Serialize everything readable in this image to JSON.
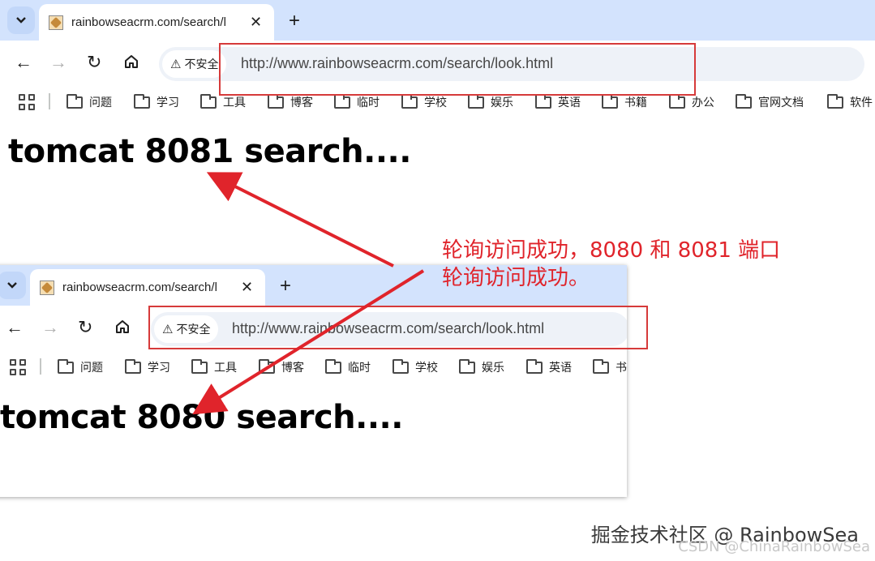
{
  "window_top": {
    "tab_title": "rainbowseacrm.com/search/l",
    "url": "http://www.rainbowseacrm.com/search/look.html",
    "security_label": "不安全",
    "bookmarks": [
      "问题",
      "学习",
      "工具",
      "博客",
      "临时",
      "学校",
      "娱乐",
      "英语",
      "书籍",
      "办公",
      "官网文档",
      "软件"
    ],
    "heading": "tomcat 8081 search...."
  },
  "window_bottom": {
    "tab_title": "rainbowseacrm.com/search/l",
    "url": "http://www.rainbowseacrm.com/search/look.html",
    "security_label": "不安全",
    "bookmarks": [
      "问题",
      "学习",
      "工具",
      "博客",
      "临时",
      "学校",
      "娱乐",
      "英语",
      "书"
    ],
    "heading": "tomcat 8080 search...."
  },
  "icons": {
    "tab_menu": "chevron-down-icon",
    "close": "close-icon",
    "new_tab": "plus-icon",
    "back": "back-arrow-icon",
    "forward": "forward-arrow-icon",
    "reload": "reload-icon",
    "home": "home-icon",
    "warning": "warning-icon",
    "apps": "apps-grid-icon",
    "folder": "folder-icon"
  },
  "annotation": {
    "line1": "轮询访问成功，8080 和 8081 端口",
    "line2": "轮询访问成功。"
  },
  "watermark": {
    "juejin": "掘金技术社区 @ RainbowSea",
    "csdn": "CSDN @ChinaRainbowSea"
  },
  "colors": {
    "tabstrip": "#d3e3fd",
    "omnibox": "#eef2f8",
    "annotation_red": "#e0242b",
    "highlight_box": "#d63a3a"
  }
}
